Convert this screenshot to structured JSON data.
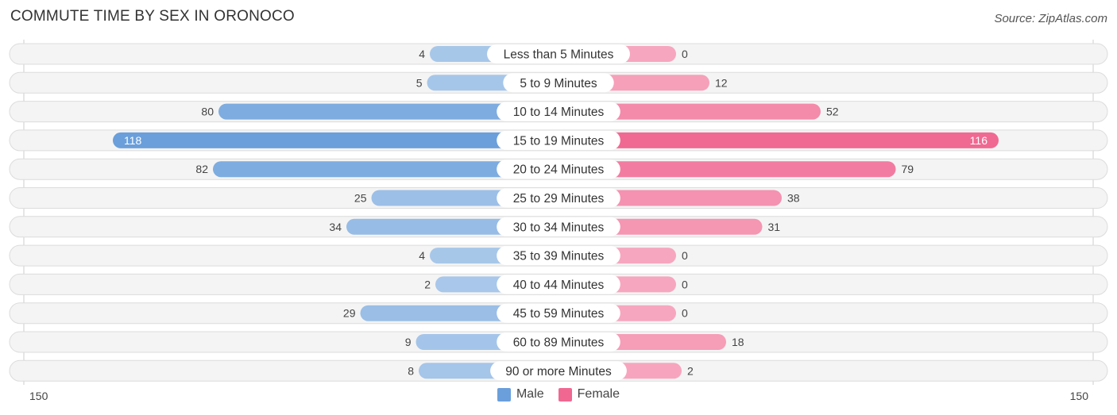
{
  "title": "COMMUTE TIME BY SEX IN ORONOCO",
  "source": "Source: ZipAtlas.com",
  "colors": {
    "male": "#6a9fdb",
    "male_light": "#a9c8ea",
    "female": "#f06892",
    "female_light": "#f7a6bf"
  },
  "legend": [
    {
      "label": "Male",
      "color": "#6a9fdb"
    },
    {
      "label": "Female",
      "color": "#f06892"
    }
  ],
  "axis": {
    "left_label": "150",
    "right_label": "150"
  },
  "chart_data": {
    "type": "bar",
    "orientation": "horizontal-diverging",
    "title": "COMMUTE TIME BY SEX IN ORONOCO",
    "categories": [
      "Less than 5 Minutes",
      "5 to 9 Minutes",
      "10 to 14 Minutes",
      "15 to 19 Minutes",
      "20 to 24 Minutes",
      "25 to 29 Minutes",
      "30 to 34 Minutes",
      "35 to 39 Minutes",
      "40 to 44 Minutes",
      "45 to 59 Minutes",
      "60 to 89 Minutes",
      "90 or more Minutes"
    ],
    "series": [
      {
        "name": "Male",
        "values": [
          4,
          5,
          80,
          118,
          82,
          25,
          34,
          4,
          2,
          29,
          9,
          8
        ]
      },
      {
        "name": "Female",
        "values": [
          0,
          12,
          52,
          116,
          79,
          38,
          31,
          0,
          0,
          0,
          18,
          2
        ]
      }
    ],
    "xlim": [
      -150,
      150
    ],
    "xtick_labels": [
      "150",
      "150"
    ],
    "legend_position": "bottom-center"
  }
}
